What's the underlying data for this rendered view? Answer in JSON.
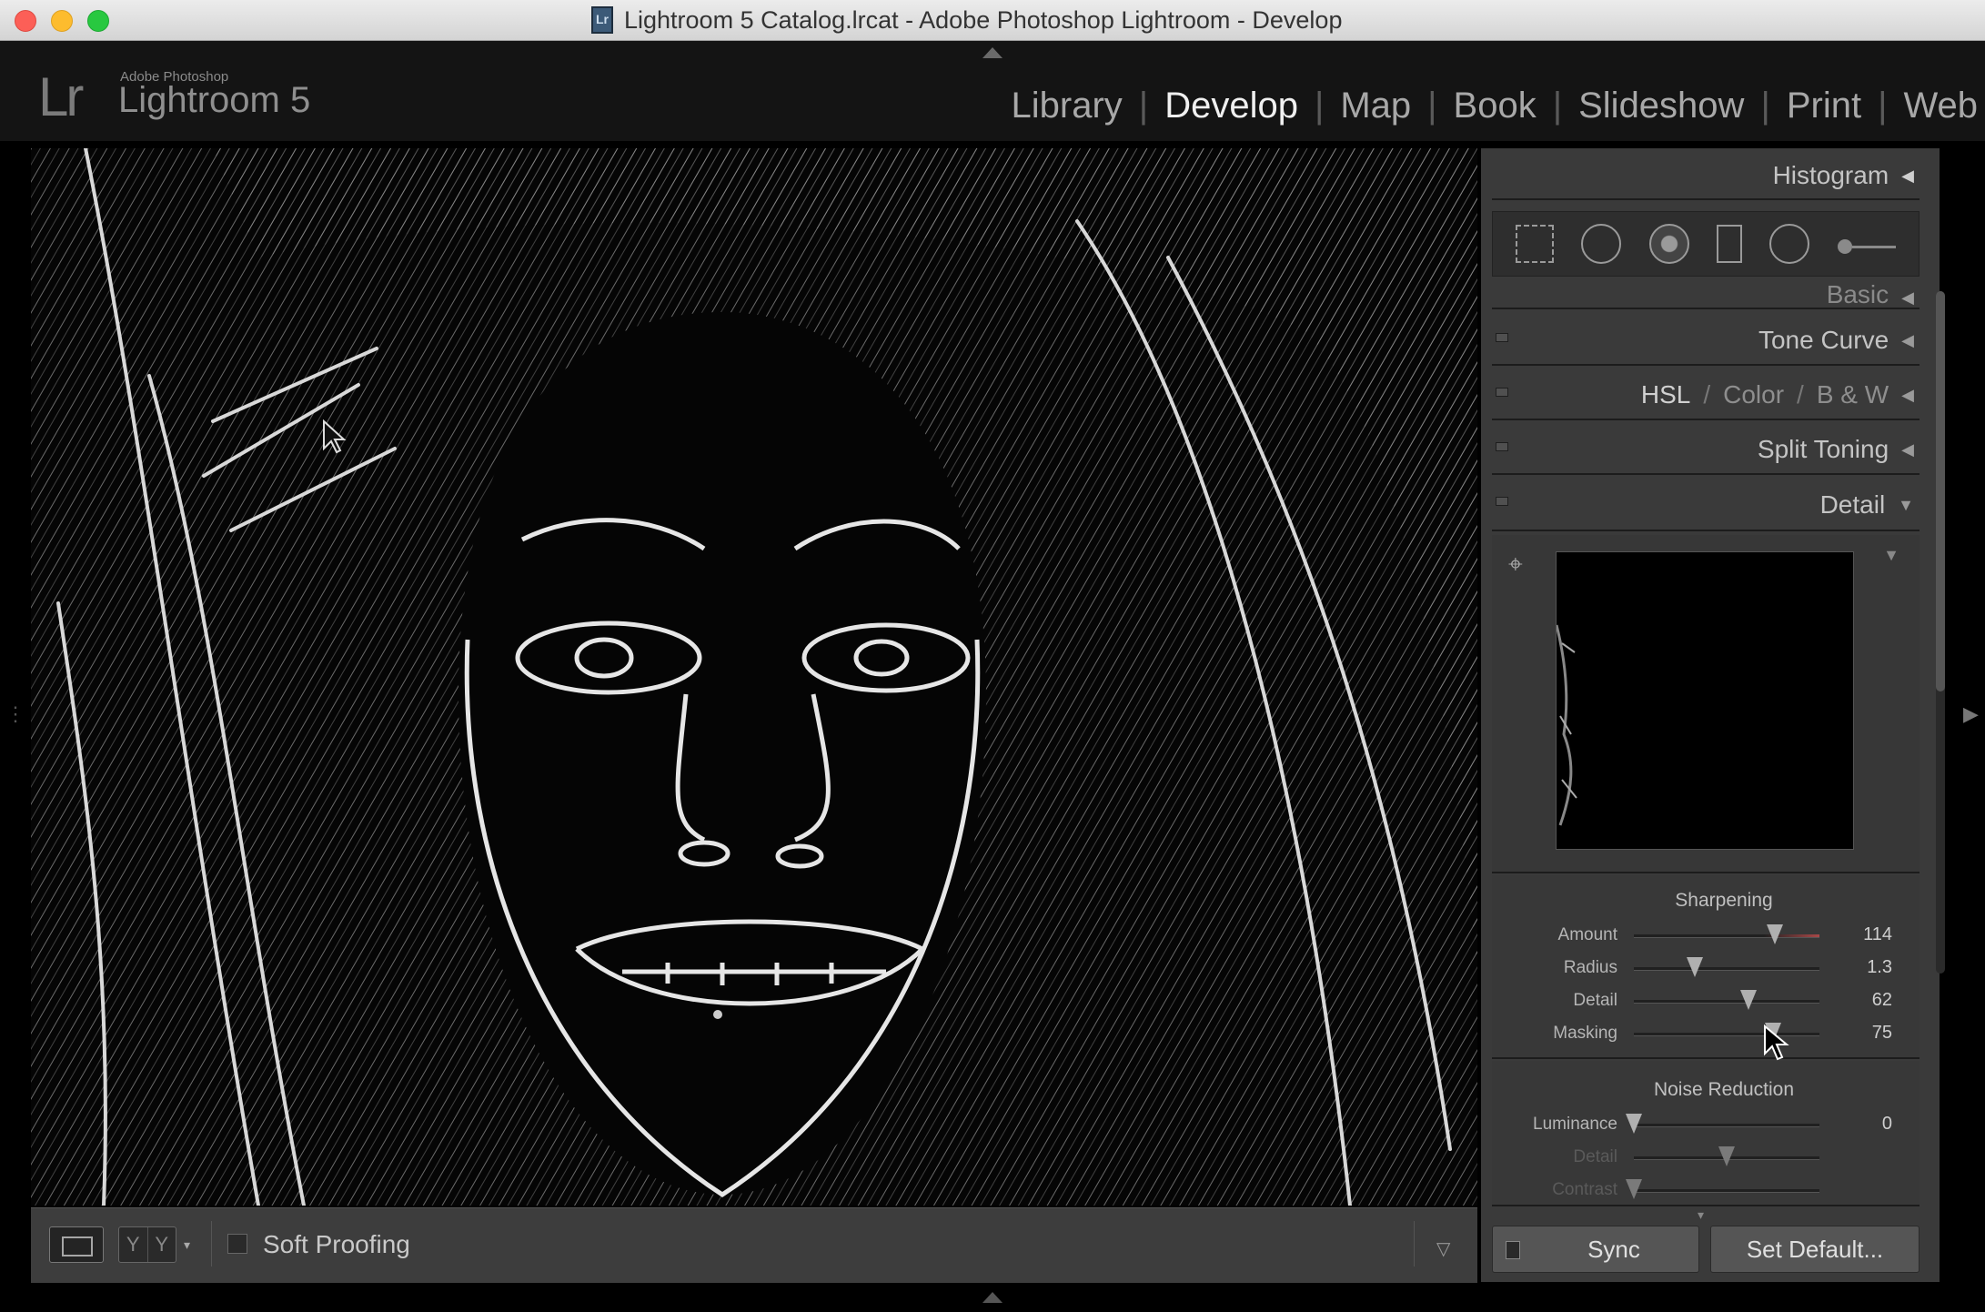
{
  "window": {
    "title": "Lightroom 5 Catalog.lrcat - Adobe Photoshop Lightroom - Develop"
  },
  "brand": {
    "logo": "Lr",
    "small": "Adobe Photoshop",
    "name": "Lightroom 5"
  },
  "modules": [
    "Library",
    "Develop",
    "Map",
    "Book",
    "Slideshow",
    "Print",
    "Web"
  ],
  "active_module": "Develop",
  "panels": {
    "histogram": "Histogram",
    "basic": "Basic",
    "tone_curve": "Tone Curve",
    "hsl": {
      "a": "HSL",
      "b": "Color",
      "c": "B & W",
      "slash": "/"
    },
    "split_toning": "Split Toning",
    "detail": "Detail"
  },
  "tools": [
    "crop-overlay",
    "spot-removal",
    "red-eye",
    "graduated-filter",
    "radial-filter",
    "adjustment-brush"
  ],
  "sharpening": {
    "title": "Sharpening",
    "rows": [
      {
        "label": "Amount",
        "value": "114",
        "fraction": 0.76
      },
      {
        "label": "Radius",
        "value": "1.3",
        "fraction": 0.33
      },
      {
        "label": "Detail",
        "value": "62",
        "fraction": 0.62
      },
      {
        "label": "Masking",
        "value": "75",
        "fraction": 0.75
      }
    ]
  },
  "noise": {
    "title": "Noise Reduction",
    "rows": [
      {
        "label": "Luminance",
        "value": "0",
        "fraction": 0.0
      },
      {
        "label": "Detail",
        "value": "",
        "fraction": 0.5
      },
      {
        "label": "Contrast",
        "value": "",
        "fraction": 0.0
      }
    ]
  },
  "toolbar": {
    "soft_proofing": "Soft Proofing",
    "yy": "Y"
  },
  "buttons": {
    "sync": "Sync",
    "set_default": "Set Default..."
  }
}
